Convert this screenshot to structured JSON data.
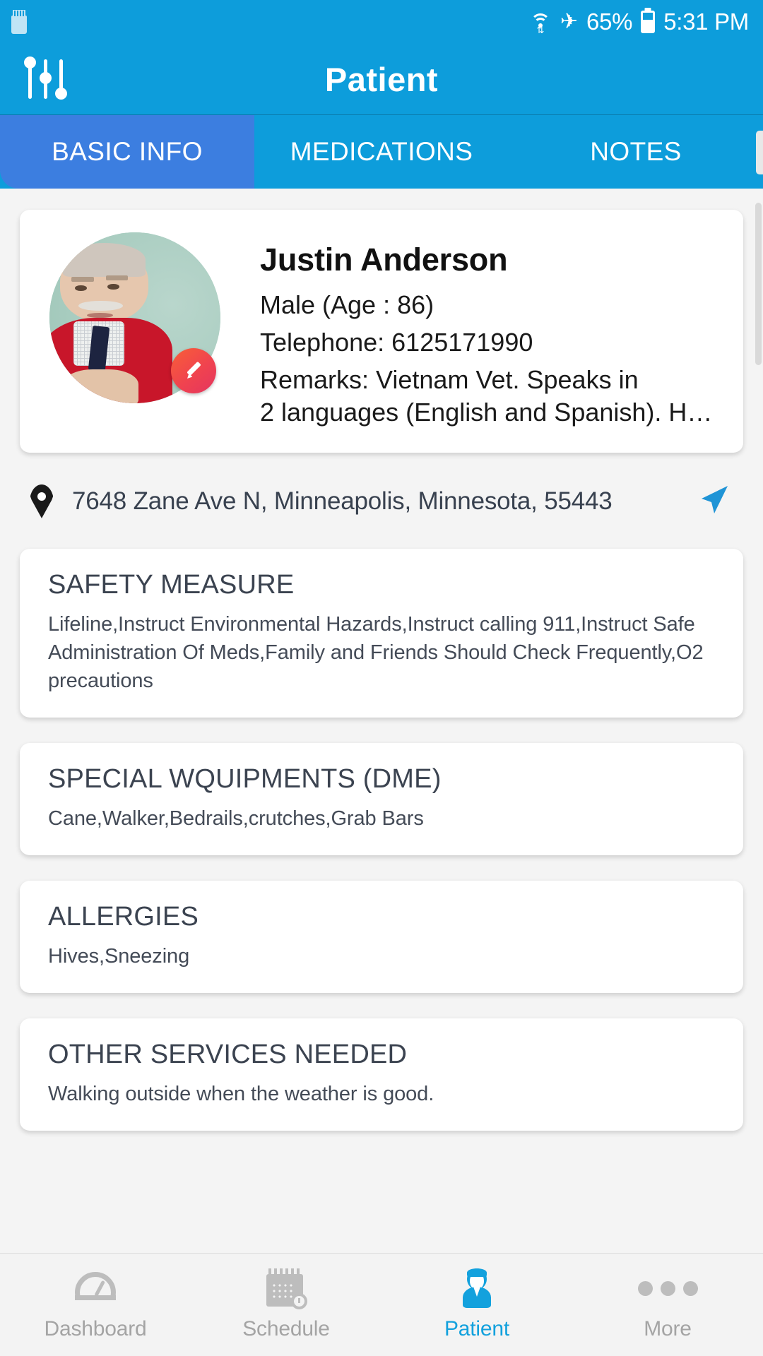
{
  "status_bar": {
    "sd_card_icon": "sd-card-icon",
    "wifi_icon": "wifi-icon",
    "airplane_icon": "airplane-mode-icon",
    "battery_percent": "65%",
    "battery_icon": "battery-icon",
    "time": "5:31 PM"
  },
  "app_bar": {
    "title": "Patient",
    "filter_icon": "filter-sliders-icon"
  },
  "tabs": [
    {
      "label": "BASIC INFO",
      "active": true
    },
    {
      "label": "MEDICATIONS",
      "active": false
    },
    {
      "label": "NOTES",
      "active": false
    }
  ],
  "patient": {
    "avatar_icon": "patient-photo",
    "edit_icon": "pencil-edit-icon",
    "name": "Justin Anderson",
    "gender_age": "Male (Age : 86)",
    "telephone": "Telephone:  6125171990",
    "remarks_line1": "Remarks:  Vietnam Vet. Speaks in",
    "remarks_line2": "2 languages (English and Spanish). H…"
  },
  "address": {
    "pin_icon": "location-pin-icon",
    "text": "7648 Zane Ave N, Minneapolis, Minnesota, 55443",
    "navigate_icon": "navigate-arrow-icon"
  },
  "sections": [
    {
      "title": "SAFETY MEASURE",
      "body": "Lifeline,Instruct Environmental Hazards,Instruct calling 911,Instruct Safe Administration Of Meds,Family and Friends Should Check Frequently,O2 precautions"
    },
    {
      "title": "SPECIAL WQUIPMENTS (DME)",
      "body": "Cane,Walker,Bedrails,crutches,Grab Bars"
    },
    {
      "title": "ALLERGIES",
      "body": "Hives,Sneezing"
    },
    {
      "title": "OTHER SERVICES NEEDED",
      "body": "Walking outside when the weather is good."
    }
  ],
  "bottom_nav": [
    {
      "label": "Dashboard",
      "icon": "dashboard-gauge-icon",
      "active": false
    },
    {
      "label": "Schedule",
      "icon": "calendar-clock-icon",
      "active": false
    },
    {
      "label": "Patient",
      "icon": "person-icon",
      "active": true
    },
    {
      "label": "More",
      "icon": "more-dots-icon",
      "active": false
    }
  ],
  "colors": {
    "primary_blue": "#0d9ddb",
    "active_tab_blue": "#3c7ee0",
    "accent_nav_blue": "#13a1dd",
    "edit_badge_orange": "#f85f37",
    "text_dark": "#3b4350",
    "inactive_gray": "#bdbdbd"
  }
}
